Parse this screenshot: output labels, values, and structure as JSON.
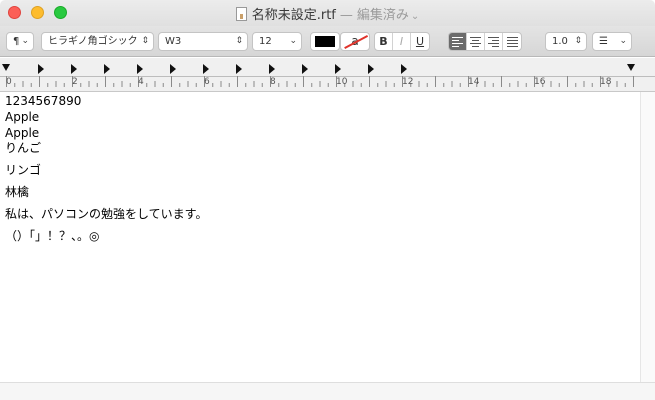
{
  "window": {
    "title": "名称未設定.rtf",
    "separator": "—",
    "status": "編集済み",
    "status_chevron": "chevron-down-icon"
  },
  "toolbar": {
    "paragraph_style": "¶",
    "font_family": "ヒラギノ角ゴシック",
    "font_weight": "W3",
    "font_size": "12",
    "text_color": "#000000",
    "highlight_label": "a",
    "bold": "B",
    "italic": "I",
    "underline": "U",
    "line_spacing": "1.0",
    "list_icon": "list-icon",
    "active_alignment": "left"
  },
  "ruler": {
    "numbers": [
      "0",
      "2",
      "4",
      "6",
      "8",
      "10",
      "12",
      "14",
      "16",
      "18"
    ]
  },
  "document": {
    "lines": [
      "1234567890",
      "Apple",
      "Apple",
      "りんご",
      "リンゴ",
      "林檎",
      "私は、パソコンの勉強をしています。",
      "（）「」！？、。◎"
    ]
  }
}
